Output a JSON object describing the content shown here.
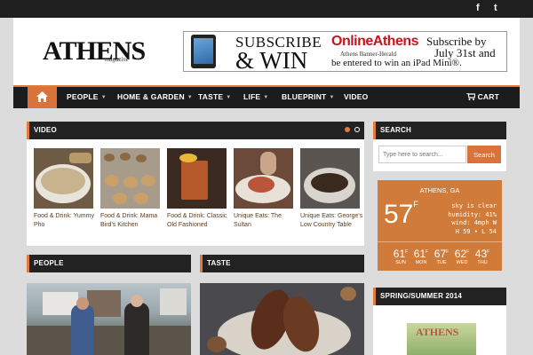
{
  "header": {
    "logo_main": "ATHENS",
    "logo_sub": "magazine",
    "social": {
      "facebook": "f",
      "twitter": "t"
    }
  },
  "ad": {
    "subscribe": "SUBSCRIBE",
    "win": "& WIN",
    "brand": "OnlineAthens",
    "brand_sub": "Athens Banner-Herald",
    "line1": "Subscribe by",
    "line2": "July 31st and",
    "line3": "be entered to win an iPad Mini®."
  },
  "nav": {
    "items": [
      "PEOPLE",
      "HOME & GARDEN",
      "TASTE",
      "LIFE",
      "BLUEPRINT",
      "VIDEO"
    ],
    "cart": "CART"
  },
  "video": {
    "title": "VIDEO",
    "items": [
      {
        "label": "Food & Drink: Yummy Pho"
      },
      {
        "label": "Food & Drink: Mama Bird's Kitchen"
      },
      {
        "label": "Food & Drink: Classic Old Fashioned"
      },
      {
        "label": "Unique Eats: The Sultan"
      },
      {
        "label": "Unique Eats: George's Low Country Table"
      }
    ]
  },
  "search": {
    "title": "SEARCH",
    "placeholder": "Type here to search...",
    "button": "Search"
  },
  "weather": {
    "city": "ATHENS, GA",
    "temp": "57",
    "unit": "F",
    "condition": "sky is clear",
    "humidity": "humidity: 41%",
    "wind": "wind: 4mph W",
    "hilo": "H 59 • L 54",
    "forecast": [
      {
        "temp": "61",
        "day": "SUN"
      },
      {
        "temp": "61",
        "day": "MON"
      },
      {
        "temp": "67",
        "day": "TUE"
      },
      {
        "temp": "62",
        "day": "WED"
      },
      {
        "temp": "43",
        "day": "THU"
      }
    ]
  },
  "sections": {
    "people": "PEOPLE",
    "taste": "TASTE",
    "spring": "SPRING/SUMMER 2014"
  },
  "colors": {
    "accent": "#d9733b",
    "dark": "#1c1c1c"
  }
}
